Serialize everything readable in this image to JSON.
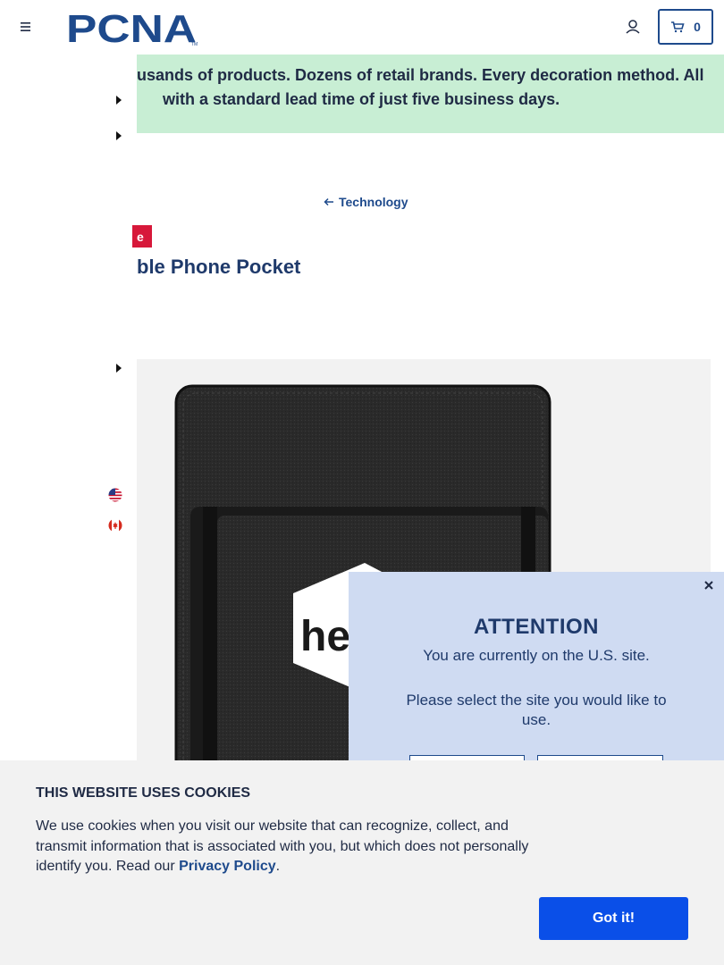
{
  "header": {
    "logo_text": "PCNA",
    "logo_tm": "TM",
    "cart_count": "0"
  },
  "promo": {
    "line1": "usands of products. Dozens of retail brands. Every decoration method. All",
    "line2": "with a standard lead time of just five business days."
  },
  "breadcrumb": {
    "back_label": "Technology"
  },
  "product": {
    "badge_text": "e",
    "title": "ble Phone Pocket",
    "image_logo_text": "he"
  },
  "modal": {
    "title": "ATTENTION",
    "current_site_text": "You are currently on the U.S. site.",
    "prompt": "Please select the site you would like to use.",
    "close_symbol": "×"
  },
  "cookie": {
    "title": "THIS WEBSITE USES COOKIES",
    "text": "We use cookies when you visit our website that can recognize, collect, and transmit information that is associated with you, but which does not personally identify you. Read our",
    "link_label": "Privacy Policy",
    "text_end": ".",
    "button_label": "Got it!"
  },
  "colors": {
    "brand_blue": "#1e4a8c",
    "promo_green": "#c8eed4",
    "badge_red": "#d7183a",
    "modal_bg": "#cfdbf2",
    "cookie_button": "#0a4fe8"
  },
  "icons": {
    "menu": "hamburger-icon",
    "account": "user-icon",
    "cart": "cart-icon",
    "back": "arrow-left-icon",
    "caret": "caret-right-icon",
    "flag_us": "us-flag-icon",
    "flag_ca": "canada-flag-icon",
    "close": "close-icon"
  }
}
